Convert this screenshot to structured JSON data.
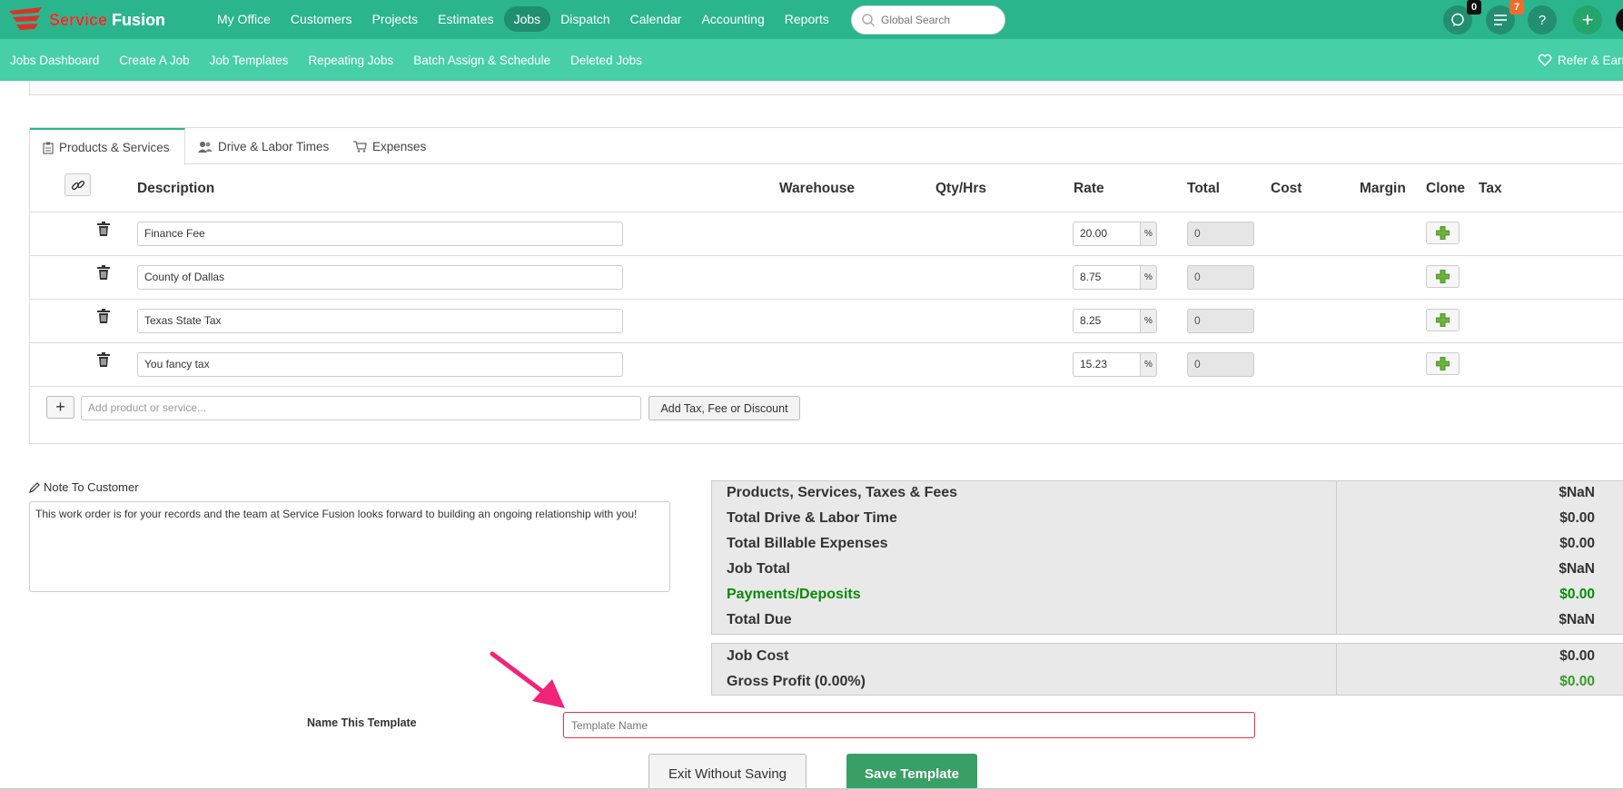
{
  "brand": {
    "name_part1": "Service",
    "name_part2": " Fusion"
  },
  "mainnav": [
    "My Office",
    "Customers",
    "Projects",
    "Estimates",
    "Jobs",
    "Dispatch",
    "Calendar",
    "Accounting",
    "Reports"
  ],
  "mainnav_active": "Jobs",
  "search": {
    "placeholder": "Global Search"
  },
  "header_badges": {
    "chat_count": "0",
    "tasks_count": "7",
    "help": "?",
    "add": "+"
  },
  "subnav": [
    "Jobs Dashboard",
    "Create A Job",
    "Job Templates",
    "Repeating Jobs",
    "Batch Assign & Schedule",
    "Deleted Jobs"
  ],
  "refer_label": "Refer & Earn",
  "tabs": [
    "Products & Services",
    "Drive & Labor Times",
    "Expenses"
  ],
  "columns": {
    "description": "Description",
    "warehouse": "Warehouse",
    "qty": "Qty/Hrs",
    "rate": "Rate",
    "total": "Total",
    "cost": "Cost",
    "margin": "Margin",
    "clone": "Clone",
    "tax": "Tax"
  },
  "line_items": [
    {
      "description": "Finance Fee",
      "rate": "20.00",
      "unit": "%",
      "total": "0"
    },
    {
      "description": "County of Dallas",
      "rate": "8.75",
      "unit": "%",
      "total": "0"
    },
    {
      "description": "Texas State Tax",
      "rate": "8.25",
      "unit": "%",
      "total": "0"
    },
    {
      "description": "You fancy tax",
      "rate": "15.23",
      "unit": "%",
      "total": "0"
    }
  ],
  "add_row": {
    "plus": "+",
    "placeholder": "Add product or service...",
    "add_tax_label": "Add Tax, Fee or Discount"
  },
  "note": {
    "label": "Note To Customer",
    "text": "This work order is for your records and the team at Service Fusion looks forward to building an ongoing relationship with you!"
  },
  "totals": [
    {
      "label": "Products, Services, Taxes & Fees",
      "value": "$NaN"
    },
    {
      "label": "Total Drive & Labor Time",
      "value": "$0.00"
    },
    {
      "label": "Total Billable Expenses",
      "value": "$0.00"
    },
    {
      "label": "Job Total",
      "value": "$NaN"
    },
    {
      "label": "Payments/Deposits",
      "value": "$0.00"
    },
    {
      "label": "Total Due",
      "value": "$NaN"
    }
  ],
  "costs": [
    {
      "label": "Job Cost",
      "value": "$0.00"
    },
    {
      "label": "Gross Profit (0.00%)",
      "value": "$0.00"
    }
  ],
  "template": {
    "label": "Name This Template",
    "placeholder": "Template Name"
  },
  "buttons": {
    "exit": "Exit Without Saving",
    "save": "Save Template"
  },
  "colors": {
    "topbar": "#2bb58d",
    "subnav": "#47cfa8",
    "save": "#38a064",
    "highlight": "#e8334a",
    "arrow": "#f0247a"
  }
}
